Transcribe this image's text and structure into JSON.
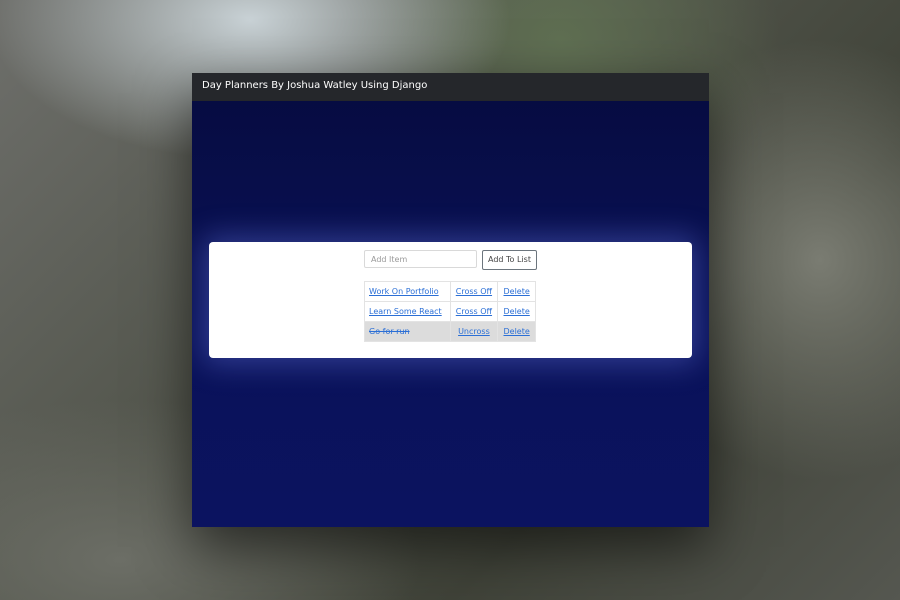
{
  "navbar": {
    "title": "Day Planners By Joshua Watley Using Django"
  },
  "add_form": {
    "placeholder": "Add Item",
    "button_label": "Add To List"
  },
  "todo_list": {
    "items": [
      {
        "label": "Work On Portfolio",
        "action": "Cross Off",
        "delete": "Delete",
        "completed": false
      },
      {
        "label": "Learn Some React",
        "action": "Cross Off",
        "delete": "Delete",
        "completed": false
      },
      {
        "label": "Go for run",
        "action": "Uncross",
        "delete": "Delete",
        "completed": true
      }
    ]
  },
  "colors": {
    "navbar_bg": "#25272b",
    "page_bg": "#0a1258",
    "link": "#2b6fd6",
    "completed_row_bg": "#dcdcdc"
  }
}
